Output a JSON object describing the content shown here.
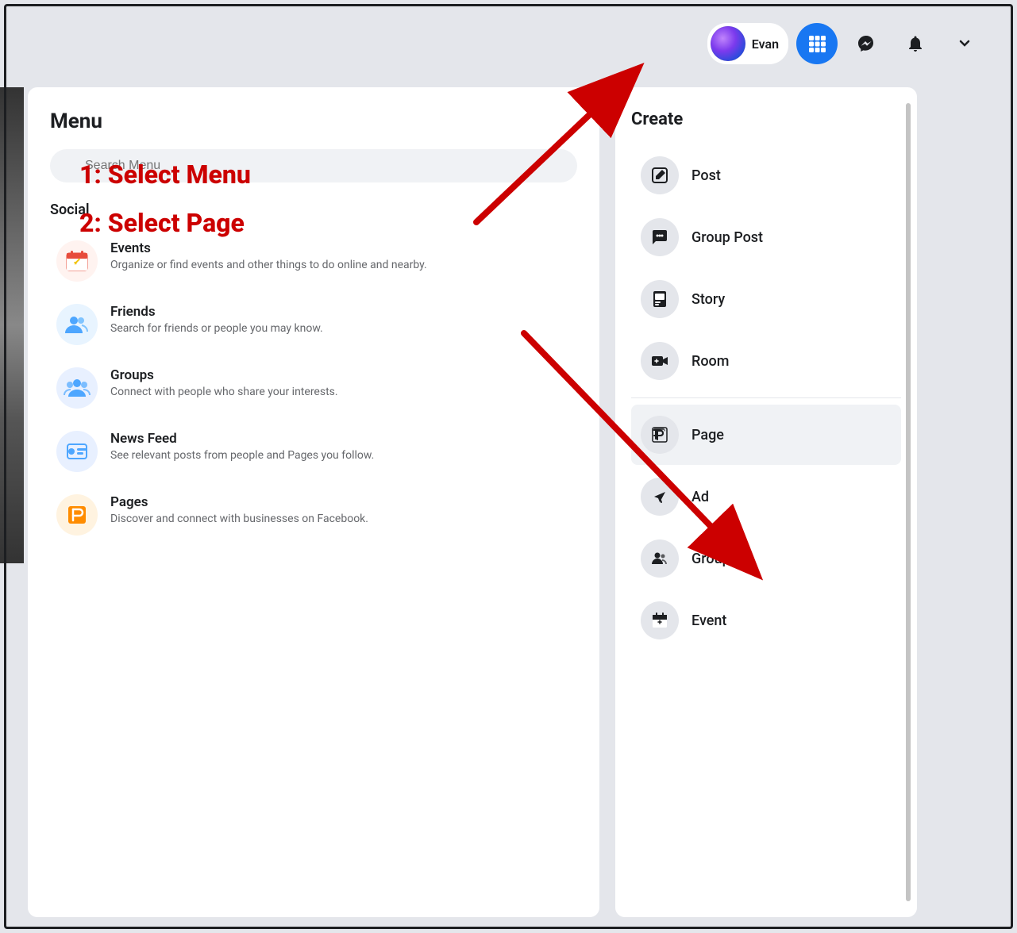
{
  "navbar": {
    "user": {
      "name": "Evan"
    },
    "icons": {
      "grid": "⊞",
      "messenger": "💬",
      "bell": "🔔",
      "dropdown": "▼"
    }
  },
  "menu": {
    "title": "Menu",
    "search": {
      "placeholder": "Search Menu"
    },
    "social_section": "Social",
    "items": [
      {
        "name": "Events",
        "description": "Organize or find events and other things to do online and nearby.",
        "icon": "📅"
      },
      {
        "name": "Friends",
        "description": "Search for friends or people you may know.",
        "icon": "👥"
      },
      {
        "name": "Groups",
        "description": "Connect with people who share your interests.",
        "icon": "👥"
      },
      {
        "name": "News Feed",
        "description": "See relevant posts from people and Pages you follow.",
        "icon": "📰"
      },
      {
        "name": "Pages",
        "description": "Discover and connect with businesses on Facebook.",
        "icon": "🚩"
      }
    ]
  },
  "create": {
    "title": "Create",
    "items": [
      {
        "label": "Post",
        "icon": "✏️",
        "selected": false
      },
      {
        "label": "Group Post",
        "icon": "💬",
        "selected": false
      },
      {
        "label": "Story",
        "icon": "📖",
        "selected": false
      },
      {
        "label": "Room",
        "icon": "📹",
        "selected": false
      },
      {
        "label": "Page",
        "icon": "🚩",
        "selected": true
      },
      {
        "label": "Ad",
        "icon": "📢",
        "selected": false
      },
      {
        "label": "Group",
        "icon": "👥",
        "selected": false
      },
      {
        "label": "Event",
        "icon": "📅",
        "selected": false
      }
    ]
  },
  "instructions": {
    "step1": "1: Select Menu",
    "step2": "2: Select Page"
  }
}
